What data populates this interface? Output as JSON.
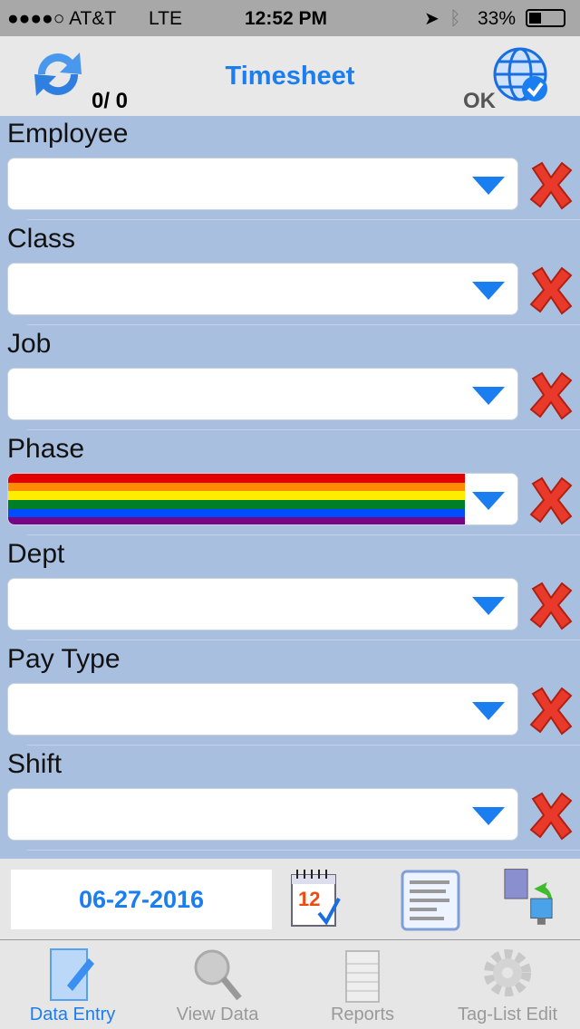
{
  "status_bar": {
    "carrier": "●●●●○ AT&T",
    "network": "LTE",
    "time": "12:52 PM",
    "battery": "33%"
  },
  "header": {
    "title": "Timesheet",
    "counter": "0/  0",
    "status": "OK",
    "refresh_icon": "refresh-icon",
    "globe_icon": "globe-check-icon"
  },
  "fields": [
    {
      "label": "Employee",
      "value": ""
    },
    {
      "label": "Class",
      "value": ""
    },
    {
      "label": "Job",
      "value": ""
    },
    {
      "label": "Phase",
      "value": "",
      "rainbow": true
    },
    {
      "label": "Dept",
      "value": ""
    },
    {
      "label": "Pay Type",
      "value": ""
    },
    {
      "label": "Shift",
      "value": ""
    }
  ],
  "rainbow_colors": [
    "#e30000",
    "#ff8c00",
    "#ffed00",
    "#008026",
    "#004dff",
    "#750787"
  ],
  "bottom": {
    "date": "06-27-2016"
  },
  "tabs": [
    {
      "label": "Data Entry",
      "active": true
    },
    {
      "label": "View Data"
    },
    {
      "label": "Reports"
    },
    {
      "label": "Tag-List Edit"
    }
  ],
  "colors": {
    "accent": "#1a7ef0",
    "form_bg": "#a9bfe0",
    "clear": "#e8392a"
  }
}
